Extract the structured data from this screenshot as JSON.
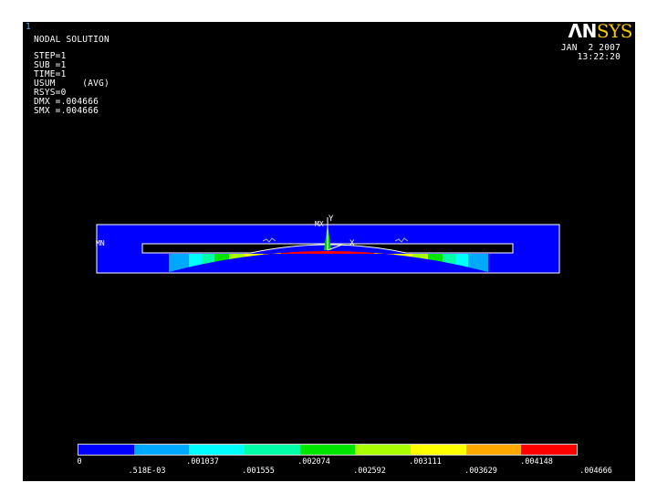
{
  "header": {
    "window_number": "1",
    "title": "NODAL SOLUTION",
    "info_lines": [
      "STEP=1",
      "SUB =1",
      "TIME=1",
      "USUM     (AVG)",
      "RSYS=0",
      "DMX =.004666",
      "SMX =.004666"
    ],
    "logo_part_1": "ΛN",
    "logo_part_2": "SYS",
    "date": "JAN  2 2007",
    "time": "13:22:20"
  },
  "model": {
    "label_mx": "MX",
    "label_mn": "MN",
    "axis_y": "Y",
    "axis_x": "X"
  },
  "legend": {
    "colors": [
      "#0000ff",
      "#00a8ff",
      "#00ffff",
      "#00ffa8",
      "#00e600",
      "#a8ff00",
      "#ffff00",
      "#ffa800",
      "#ff0000"
    ],
    "labels": [
      "0",
      ".518E-03",
      ".001037",
      ".001555",
      ".002074",
      ".002592",
      ".003111",
      ".003629",
      ".004148",
      ".004666"
    ]
  },
  "colors": {
    "background": "#000000",
    "frame": "#ffffff",
    "body": "#0000ff",
    "max_zone": "#ff0000"
  }
}
